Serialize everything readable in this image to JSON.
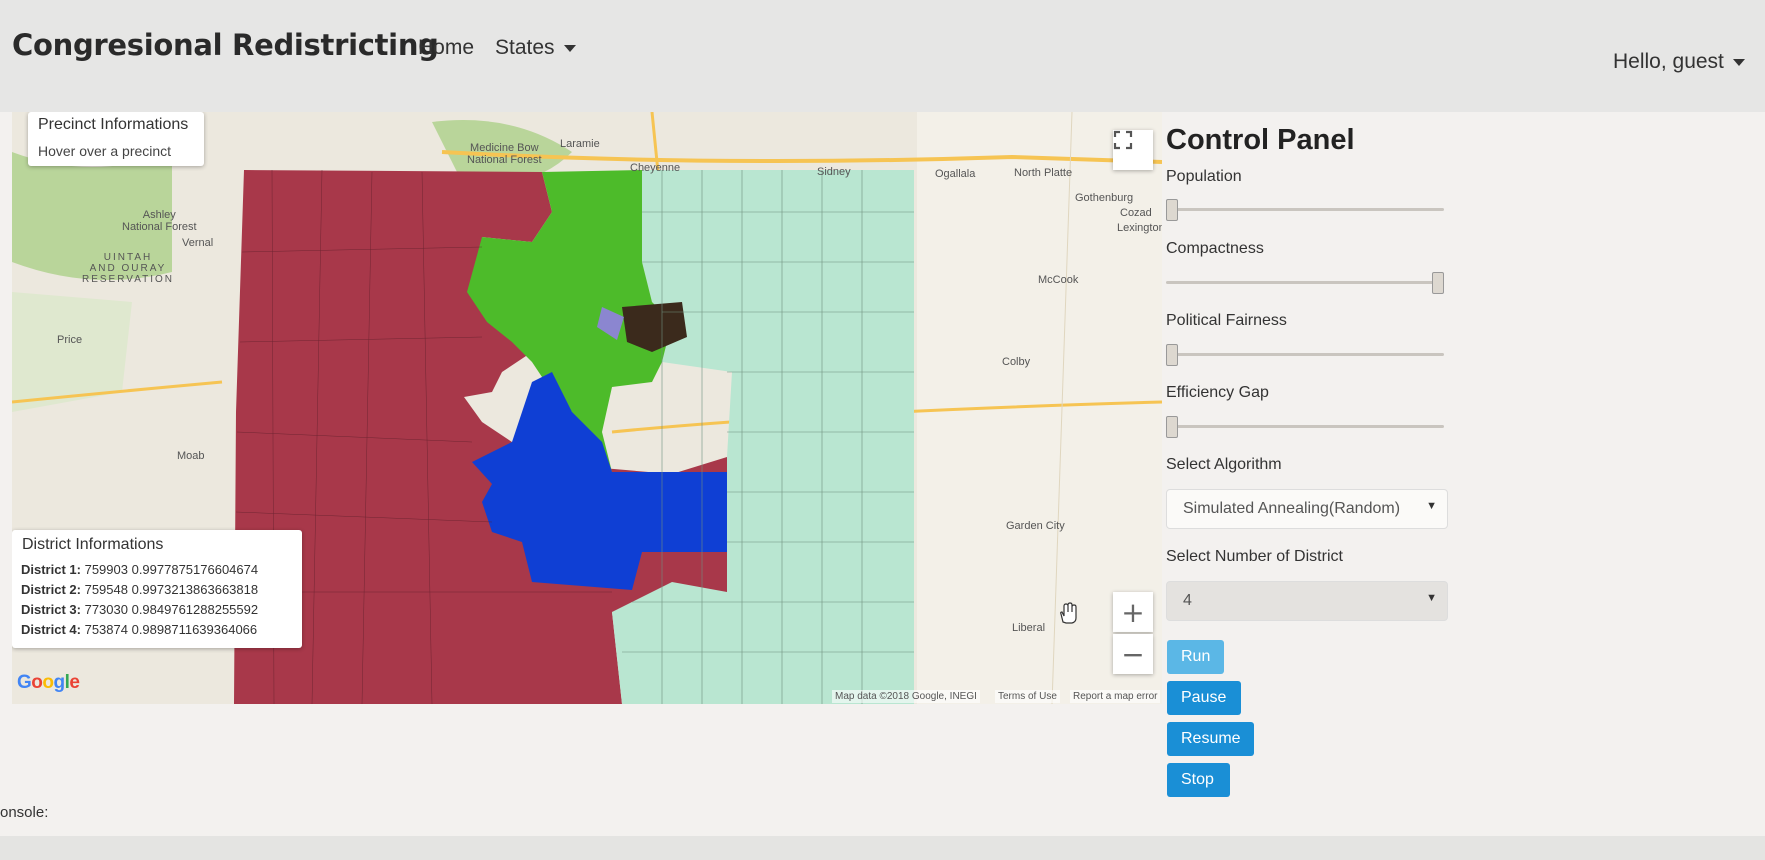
{
  "navbar": {
    "brand": "Congresional Redistricting",
    "home": "Home",
    "states": "States",
    "greeting": "Hello, guest"
  },
  "map": {
    "precinct_box": {
      "title": "Precinct Informations",
      "hint": "Hover over a precinct"
    },
    "district_box": {
      "title": "District Informations",
      "rows": [
        {
          "label": "District 1:",
          "value": "759903 0.9977875176604674"
        },
        {
          "label": "District 2:",
          "value": "759548 0.9973213863663818"
        },
        {
          "label": "District 3:",
          "value": "773030 0.9849761288255592"
        },
        {
          "label": "District 4:",
          "value": "753874 0.9898711639364066"
        }
      ]
    },
    "labels": {
      "medicine_bow": "Medicine Bow\nNational Forest",
      "laramie": "Laramie",
      "cheyenne": "Cheyenne",
      "sidney": "Sidney",
      "ogallala": "Ogallala",
      "north_platte": "North Platte",
      "gothenburg": "Gothenburg",
      "cozad": "Cozad",
      "lexington": "Lexington",
      "ashley": "Ashley\nNational Forest",
      "vernal": "Vernal",
      "uintah": "UINTAH\nAND OURAY\nRESERVATION",
      "price": "Price",
      "moab": "Moab",
      "mccook": "McCook",
      "colby": "Colby",
      "garden_city": "Garden City",
      "liberal": "Liberal"
    },
    "google_logo": "Google",
    "attribution": {
      "data": "Map data ©2018 Google, INEGI",
      "terms": "Terms of Use",
      "report": "Report a map error"
    },
    "zoom_in": "+",
    "zoom_out": "−",
    "district_colors": {
      "d1": "#a8384a",
      "d2": "#4dbb2a",
      "d3": "#0f3fd4",
      "d4": "#b9e6d1"
    }
  },
  "control_panel": {
    "title": "Control Panel",
    "sliders": [
      {
        "label": "Population",
        "level": 0.0
      },
      {
        "label": "Compactness",
        "level": 1.0
      },
      {
        "label": "Political Fairness",
        "level": 0.0
      },
      {
        "label": "Efficiency Gap",
        "level": 0.0
      }
    ],
    "algorithm_label": "Select Algorithm",
    "algorithm_value": "Simulated Annealing(Random)",
    "district_count_label": "Select Number of District",
    "district_count_value": "4",
    "buttons": {
      "run": "Run",
      "pause": "Pause",
      "resume": "Resume",
      "stop": "Stop"
    }
  },
  "console": {
    "label": "onsole:"
  },
  "icons": {
    "fullscreen": "fullscreen-icon",
    "caret": "caret-down-icon",
    "dropdown": "dropdown-arrow-icon",
    "cursor": "hand-cursor-icon"
  }
}
